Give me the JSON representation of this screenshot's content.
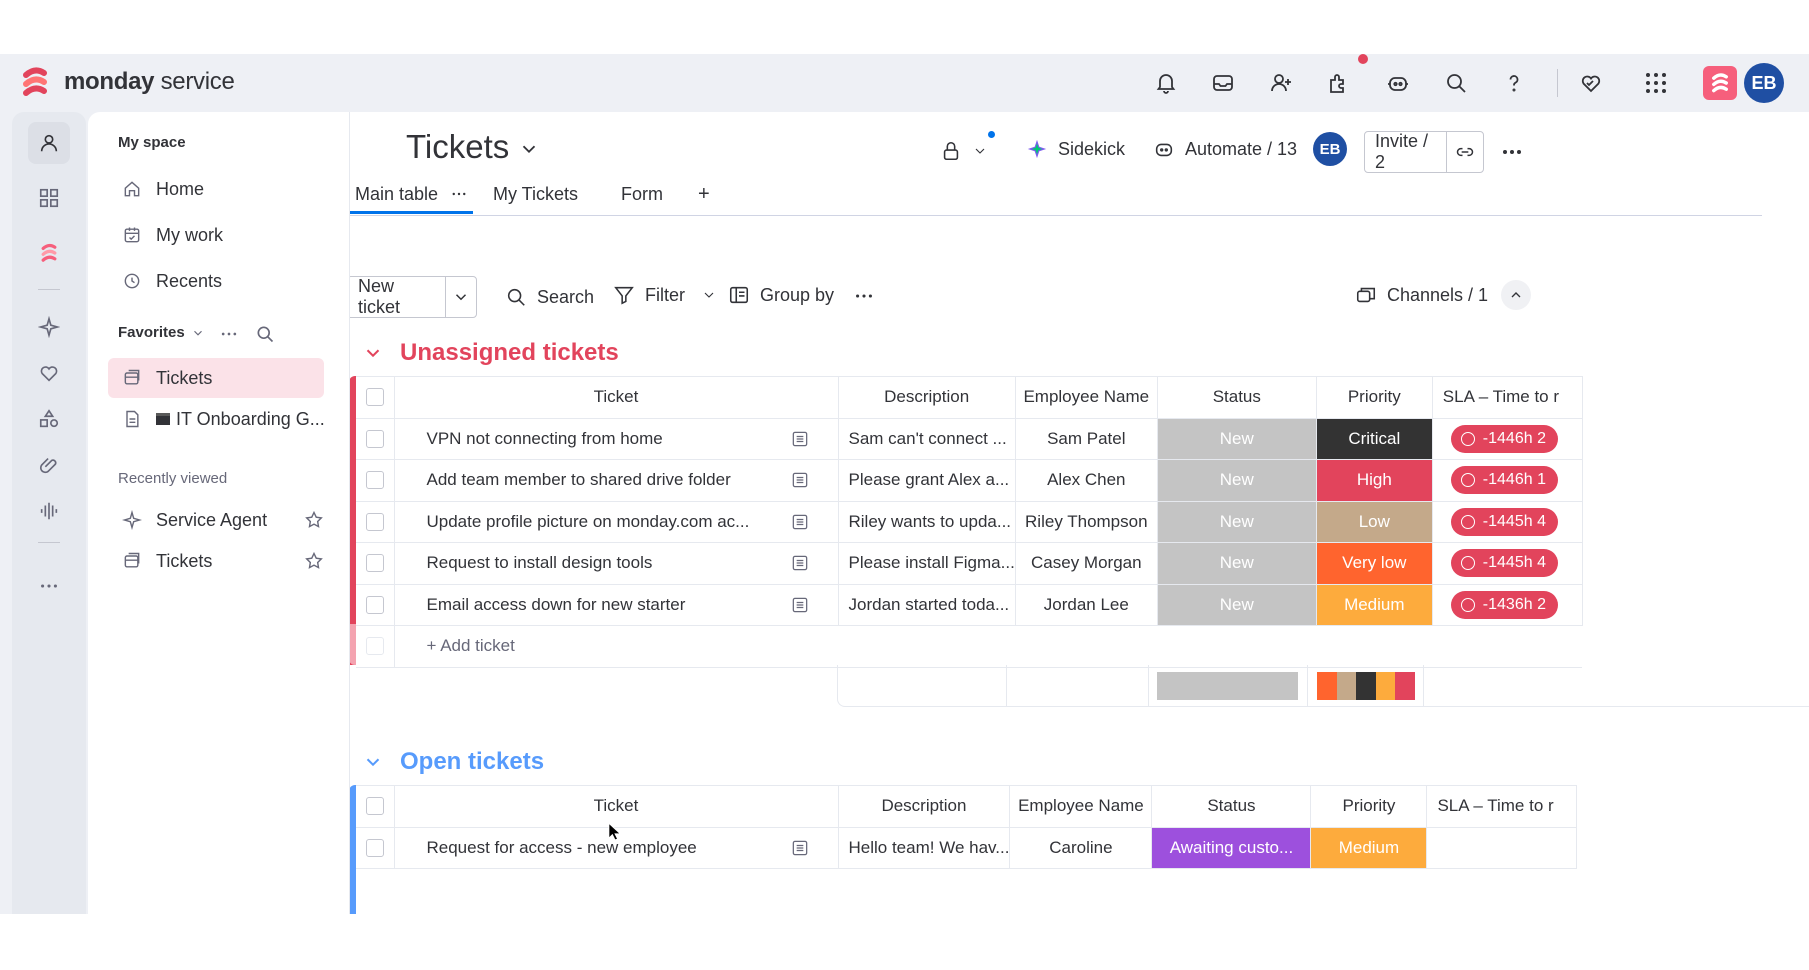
{
  "app": {
    "brand_bold": "monday",
    "brand_light": "service"
  },
  "topbar": {
    "icons": [
      "bell-icon",
      "inbox-icon",
      "invite-members-icon",
      "apps-icon",
      "ai-bot-icon",
      "search-icon",
      "help-icon",
      "heart-icon",
      "grid-menu-icon"
    ],
    "avatar": "EB"
  },
  "sidebar": {
    "section_title": "My space",
    "nav": [
      {
        "label": "Home",
        "icon": "home-icon"
      },
      {
        "label": "My work",
        "icon": "calendar-check-icon"
      },
      {
        "label": "Recents",
        "icon": "clock-icon"
      }
    ],
    "favorites_title": "Favorites",
    "favorites": [
      {
        "label": "Tickets",
        "icon": "board-icon"
      },
      {
        "label": "IT Onboarding G...",
        "icon": "doc-icon"
      }
    ],
    "recent_title": "Recently viewed",
    "recent": [
      {
        "label": "Service Agent",
        "icon": "sparkle-icon"
      },
      {
        "label": "Tickets",
        "icon": "board-icon"
      }
    ]
  },
  "board": {
    "title": "Tickets",
    "sidekick": "Sidekick",
    "automate": "Automate / 13",
    "avatar": "EB",
    "invite": "Invite / 2",
    "tabs": [
      "Main table",
      "My Tickets",
      "Form"
    ],
    "toolbar": {
      "new_ticket": "New ticket",
      "search": "Search",
      "filter": "Filter",
      "group_by": "Group by",
      "channels": "Channels / 1"
    }
  },
  "columns": [
    "Ticket",
    "Description",
    "Employee Name",
    "Status",
    "Priority",
    "SLA – Time to r"
  ],
  "groups": [
    {
      "title": "Unassigned tickets",
      "color": "#e2445c",
      "rows": [
        {
          "ticket": "VPN not connecting from home",
          "description": "Sam can't connect ...",
          "employee": "Sam Patel",
          "status": "New",
          "priority": "Critical",
          "priority_color": "#333333",
          "sla": "-1446h 2"
        },
        {
          "ticket": "Add team member to shared drive folder",
          "description": "Please grant Alex a...",
          "employee": "Alex Chen",
          "status": "New",
          "priority": "High",
          "priority_color": "#e2445c",
          "sla": "-1446h 1"
        },
        {
          "ticket": "Update profile picture on monday.com ac...",
          "description": "Riley wants to upda...",
          "employee": "Riley Thompson",
          "status": "New",
          "priority": "Low",
          "priority_color": "#c4a98a",
          "sla": "-1445h 4"
        },
        {
          "ticket": "Request to install design tools",
          "description": "Please install Figma...",
          "employee": "Casey Morgan",
          "status": "New",
          "priority": "Very low",
          "priority_color": "#ff642e",
          "sla": "-1445h 4"
        },
        {
          "ticket": "Email access down for new starter",
          "description": "Jordan started toda...",
          "employee": "Jordan Lee",
          "status": "New",
          "priority": "Medium",
          "priority_color": "#fdab3d",
          "sla": "-1436h 2"
        }
      ],
      "add_label": "+ Add ticket",
      "priority_summary_colors": [
        "#ff642e",
        "#c4a98a",
        "#333333",
        "#fdab3d",
        "#e2445c"
      ]
    },
    {
      "title": "Open tickets",
      "color": "#579bfc",
      "rows": [
        {
          "ticket": "Request for access - new employee",
          "description": "Hello team! We hav...",
          "employee": "Caroline",
          "status": "Awaiting custo...",
          "status_color": "#9d50dd",
          "priority": "Medium",
          "priority_color": "#fdab3d"
        }
      ]
    }
  ]
}
